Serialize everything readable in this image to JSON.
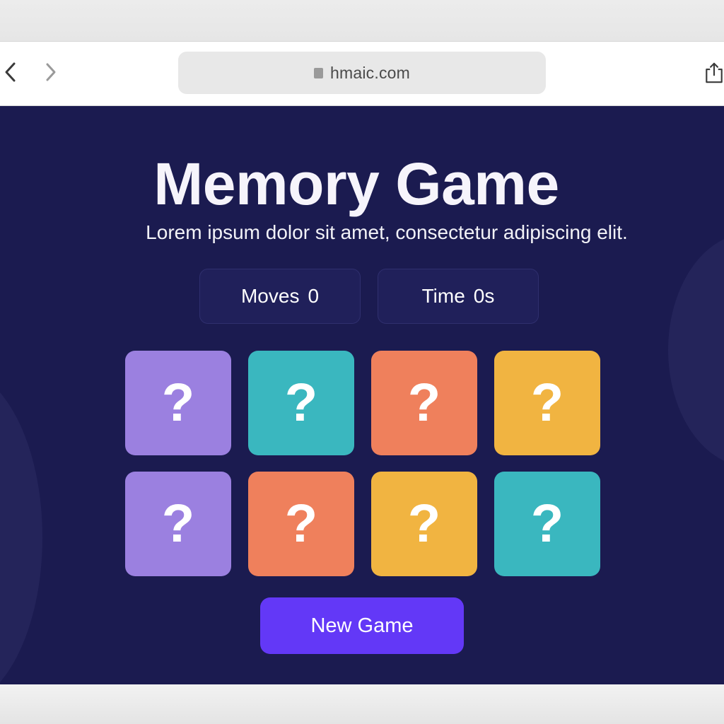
{
  "browser": {
    "url": "hmaic.com",
    "back_icon": "chevron-left-icon",
    "forward_icon": "chevron-right-icon",
    "lock_icon": "lock-icon",
    "share_icon": "share-icon"
  },
  "game": {
    "title": "Memory Game",
    "subtitle": "Lorem ipsum dolor sit amet, consectetur adipiscing elit.",
    "stats": {
      "moves_label": "Moves",
      "moves_value": "0",
      "time_label": "Time",
      "time_value": "0s"
    },
    "cards": [
      {
        "symbol": "?",
        "color": "#9b80e0"
      },
      {
        "symbol": "?",
        "color": "#3ab7bf"
      },
      {
        "symbol": "?",
        "color": "#ef805c"
      },
      {
        "symbol": "?",
        "color": "#f1b441"
      },
      {
        "symbol": "?",
        "color": "#9b80e0"
      },
      {
        "symbol": "?",
        "color": "#ef805c"
      },
      {
        "symbol": "?",
        "color": "#f1b441"
      },
      {
        "symbol": "?",
        "color": "#3ab7bf"
      }
    ],
    "new_game_label": "New Game"
  },
  "colors": {
    "background": "#1b1b50",
    "accent": "#6338f7",
    "purple": "#9b80e0",
    "teal": "#3ab7bf",
    "orange": "#ef805c",
    "yellow": "#f1b441"
  }
}
